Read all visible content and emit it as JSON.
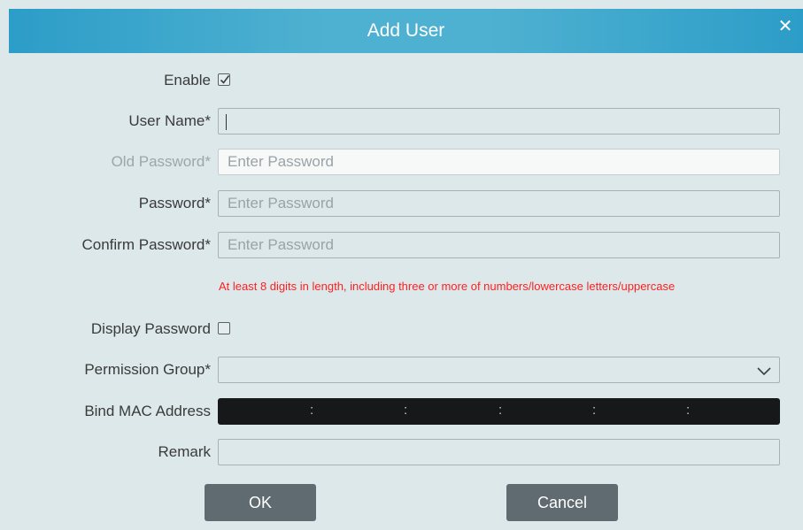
{
  "dialog": {
    "title": "Add User",
    "close_icon": "close-icon"
  },
  "form": {
    "enable": {
      "label": "Enable",
      "checked": true
    },
    "user_name": {
      "label": "User Name*",
      "value": ""
    },
    "old_password": {
      "label": "Old Password*",
      "placeholder": "Enter Password",
      "disabled": true
    },
    "password": {
      "label": "Password*",
      "placeholder": "Enter Password"
    },
    "confirm_password": {
      "label": "Confirm Password*",
      "placeholder": "Enter Password"
    },
    "password_hint": "At least 8 digits in length, including three or more of numbers/lowercase letters/uppercase",
    "display_password": {
      "label": "Display Password",
      "checked": false
    },
    "permission_group": {
      "label": "Permission Group*",
      "value": ""
    },
    "bind_mac": {
      "label": "Bind MAC Address",
      "separators": [
        ":",
        ":",
        ":",
        ":",
        ":"
      ]
    },
    "remark": {
      "label": "Remark",
      "value": ""
    }
  },
  "buttons": {
    "ok": "OK",
    "cancel": "Cancel"
  },
  "colors": {
    "title_bar": "#4fb1d1",
    "background": "#dde8eb",
    "hint": "#ff1f1f",
    "button": "#5f6a71",
    "mac_field": "#16181a"
  }
}
